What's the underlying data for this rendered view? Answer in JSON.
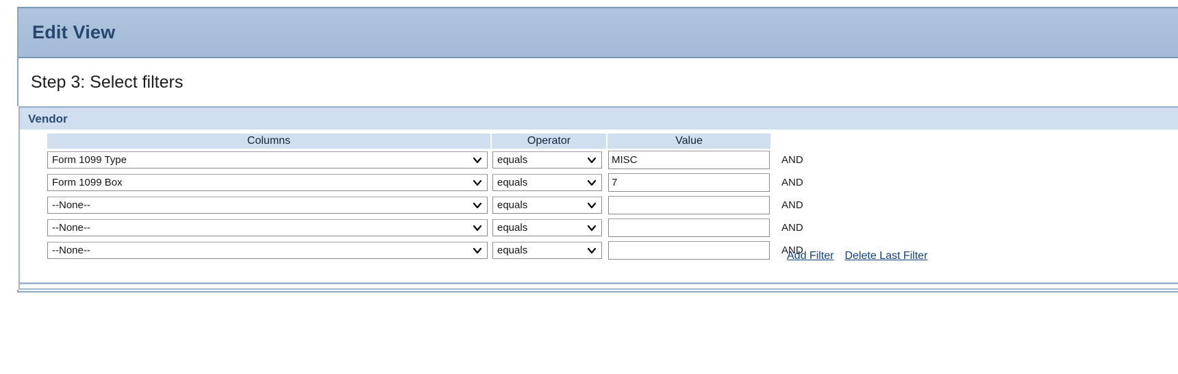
{
  "window": {
    "title": "Edit View"
  },
  "step": {
    "heading": "Step 3: Select filters"
  },
  "filter_group": {
    "title": "Vendor",
    "headers": {
      "columns": "Columns",
      "operator": "Operator",
      "value": "Value"
    },
    "rows": [
      {
        "column": "Form 1099 Type",
        "operator": "equals",
        "value": "MISC",
        "conjunction": "AND"
      },
      {
        "column": "Form 1099 Box",
        "operator": "equals",
        "value": "7",
        "conjunction": "AND"
      },
      {
        "column": "--None--",
        "operator": "equals",
        "value": "",
        "conjunction": "AND"
      },
      {
        "column": "--None--",
        "operator": "equals",
        "value": "",
        "conjunction": "AND"
      },
      {
        "column": "--None--",
        "operator": "equals",
        "value": "",
        "conjunction": "AND"
      }
    ],
    "actions": {
      "add_filter": "Add Filter",
      "delete_last_filter": "Delete Last Filter"
    }
  },
  "icons": {
    "dropdown": "chevron-down-icon"
  },
  "colors": {
    "title_bar": "#a8bfdb",
    "title_text": "#27456e",
    "group_header": "#cfdff0",
    "group_title_text": "#2b4b76",
    "link": "#13417a",
    "frame_border": "#9db4cf"
  }
}
